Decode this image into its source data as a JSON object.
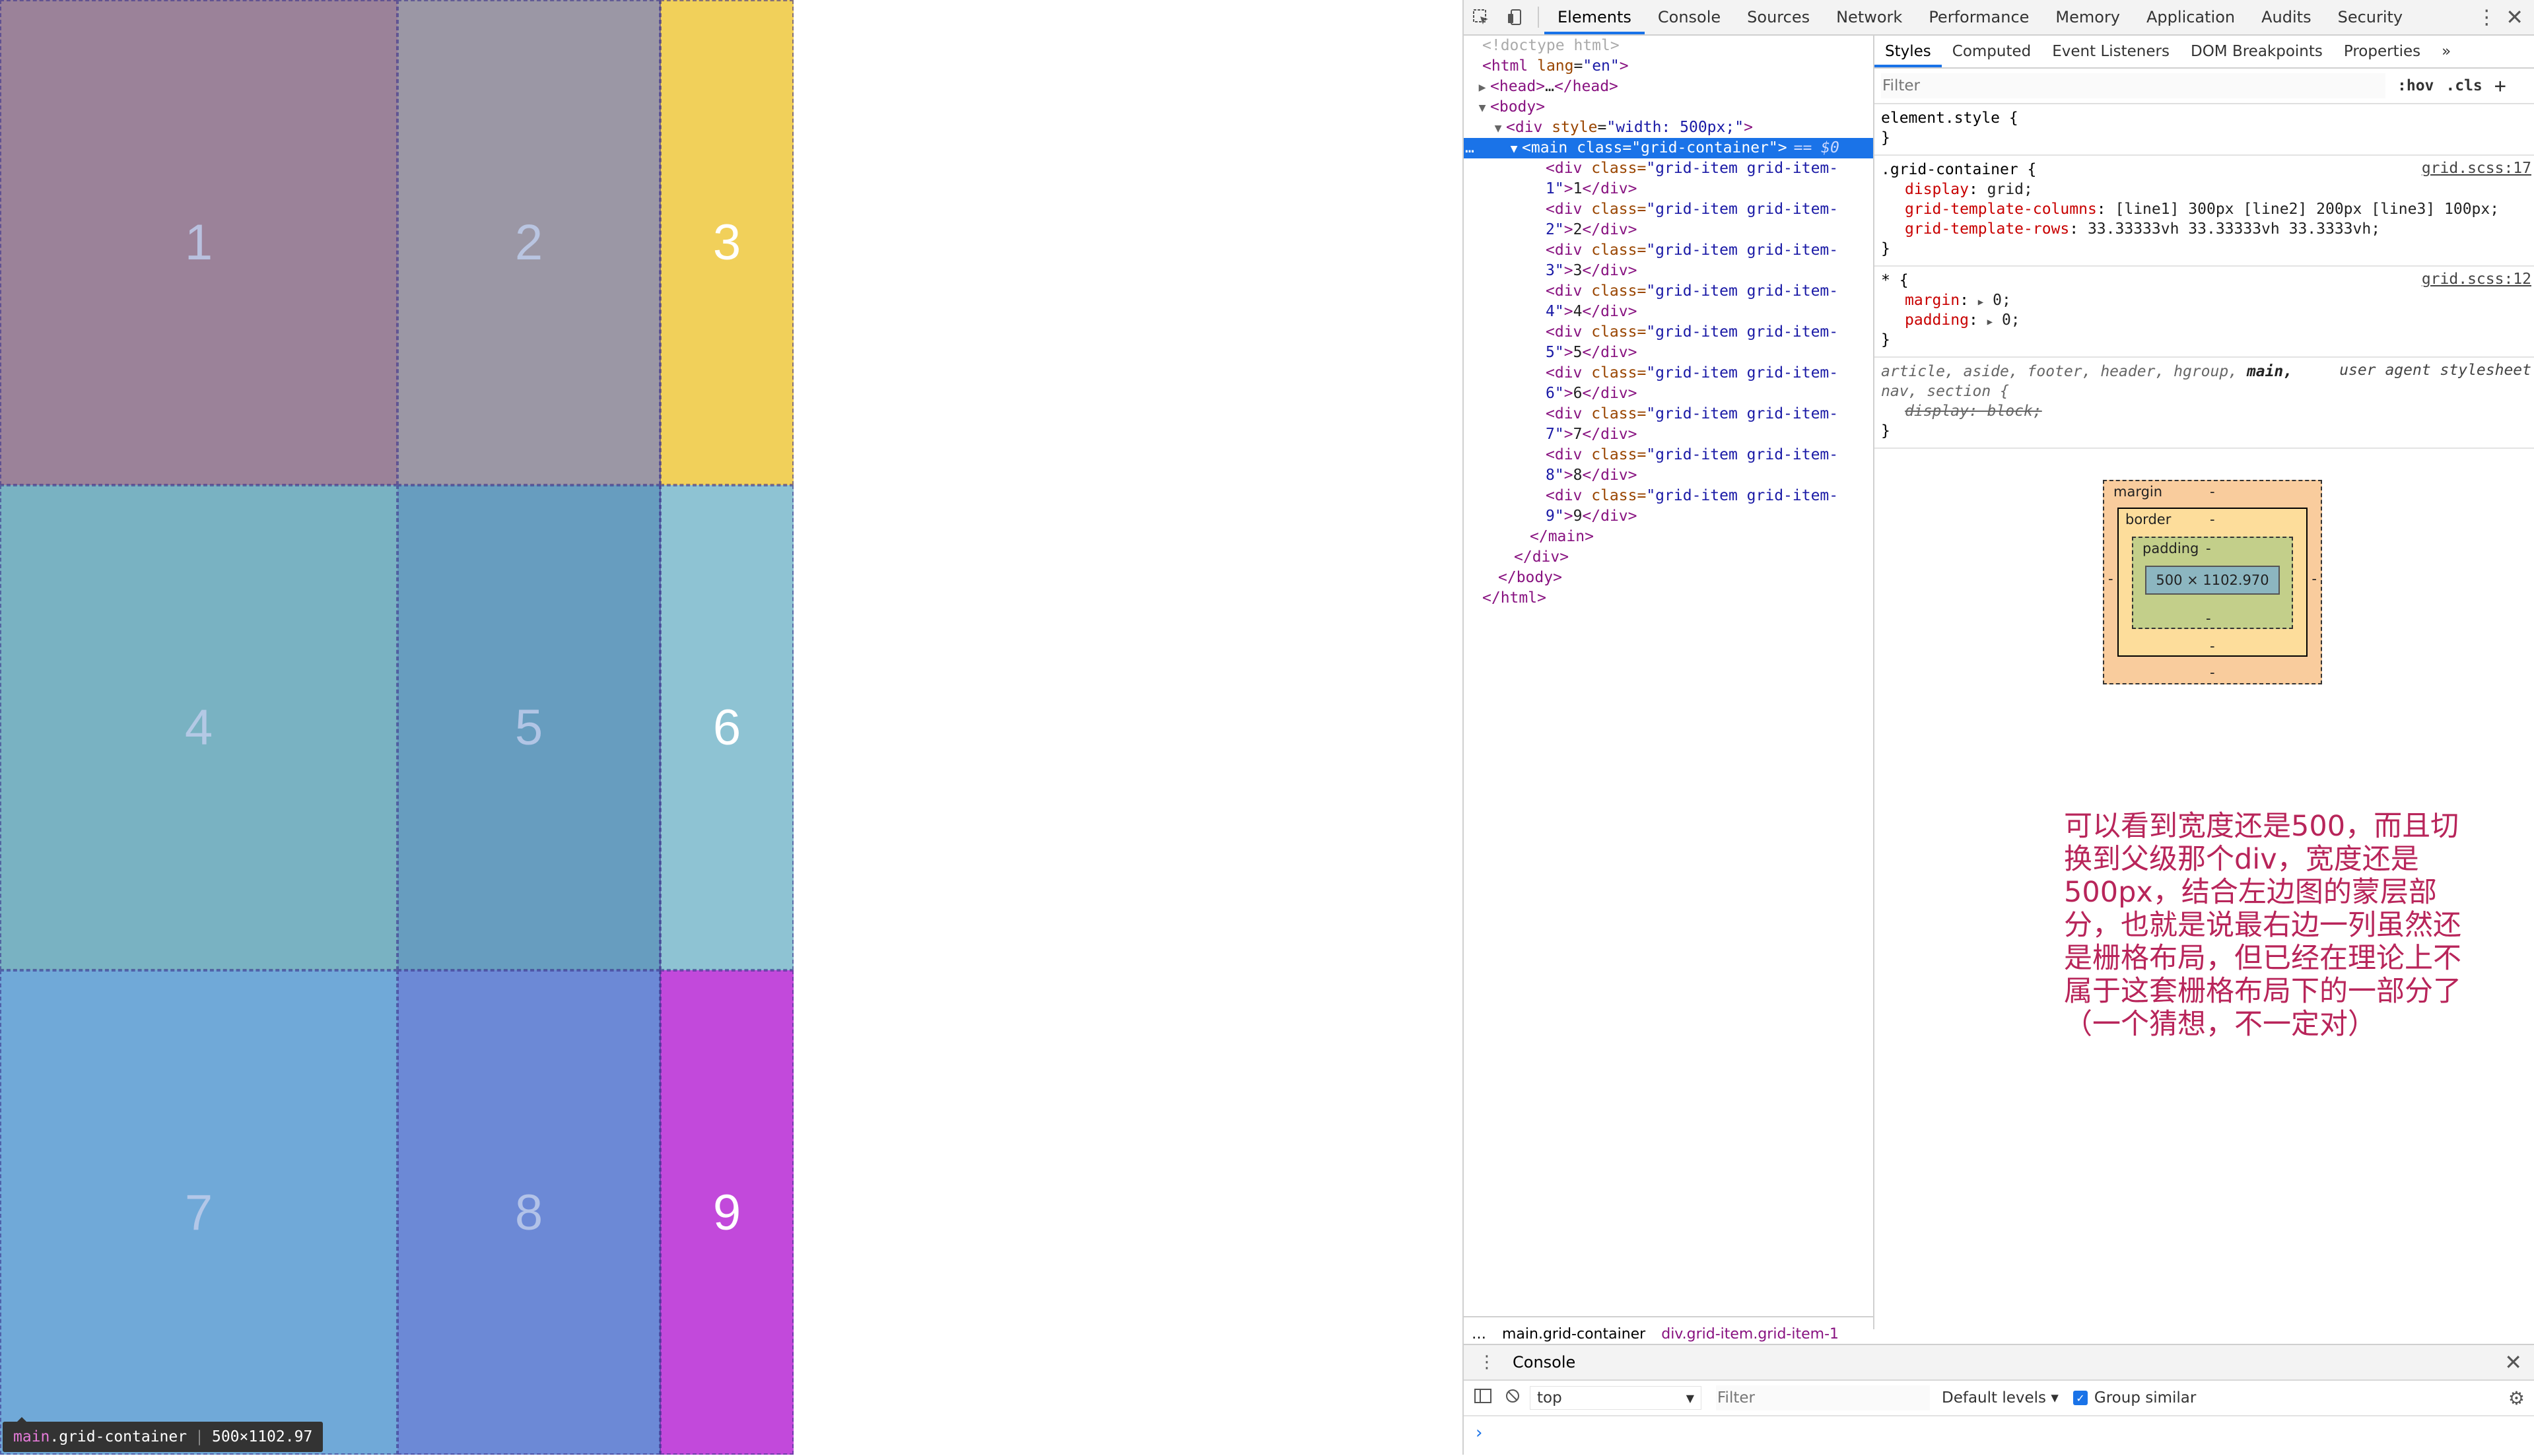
{
  "grid": {
    "cells": [
      {
        "label": "1",
        "bg": "#9b8299",
        "light": false
      },
      {
        "label": "2",
        "bg": "#9b97a5",
        "light": false
      },
      {
        "label": "3",
        "bg": "#f1d05a",
        "light": true
      },
      {
        "label": "4",
        "bg": "#79b2c2",
        "light": false
      },
      {
        "label": "5",
        "bg": "#679dbf",
        "light": false
      },
      {
        "label": "6",
        "bg": "#8ec3d3",
        "light": true
      },
      {
        "label": "7",
        "bg": "#70a9d8",
        "light": false
      },
      {
        "label": "8",
        "bg": "#6c89d6",
        "light": false
      },
      {
        "label": "9",
        "bg": "#c249db",
        "light": true
      }
    ],
    "tooltip": {
      "tag": "main",
      "cls": ".grid-container",
      "size": "500×1102.97"
    }
  },
  "devtools": {
    "tabs": [
      "Elements",
      "Console",
      "Sources",
      "Network",
      "Performance",
      "Memory",
      "Application",
      "Audits",
      "Security"
    ],
    "active_tab": "Elements",
    "dom": {
      "l0": "<!doctype html>",
      "l1_tag": "<html",
      "l1_attr": " lang",
      "l1_val": "\"en\"",
      "l1_end": ">",
      "l2_head": "<head>",
      "l2_dots": "…",
      "l2_close": "</head>",
      "l3": "<body>",
      "l4_tag": "<div",
      "l4_attr": " style",
      "l4_val": "\"width: 500px;\"",
      "l4_end": ">",
      "l5_tag": "<main",
      "l5_attr": " class",
      "l5_val": "\"grid-container\"",
      "l5_end": ">",
      "l5_eq": "== $0",
      "items": [
        {
          "a": "\"grid-item grid-item-",
          "b": "1\"",
          "n": "1"
        },
        {
          "a": "\"grid-item grid-item-",
          "b": "2\"",
          "n": "2"
        },
        {
          "a": "\"grid-item grid-item-",
          "b": "3\"",
          "n": "3"
        },
        {
          "a": "\"grid-item grid-item-",
          "b": "4\"",
          "n": "4"
        },
        {
          "a": "\"grid-item grid-item-",
          "b": "5\"",
          "n": "5"
        },
        {
          "a": "\"grid-item grid-item-",
          "b": "6\"",
          "n": "6"
        },
        {
          "a": "\"grid-item grid-item-",
          "b": "7\"",
          "n": "7"
        },
        {
          "a": "\"grid-item grid-item-",
          "b": "8\"",
          "n": "8"
        },
        {
          "a": "\"grid-item grid-item-",
          "b": "9\"",
          "n": "9"
        }
      ],
      "div_open": "<div",
      "div_class": " class=",
      "div_close_tag": "</div>",
      "close_main": "</main>",
      "close_div": "</div>",
      "close_body": "</body>",
      "close_html": "</html>"
    },
    "breadcrumb": {
      "dots": "…",
      "c1": "main.grid-container",
      "c2": "div.grid-item.grid-item-1"
    },
    "subtabs": [
      "Styles",
      "Computed",
      "Event Listeners",
      "DOM Breakpoints",
      "Properties",
      "»"
    ],
    "filter_placeholder": "Filter",
    "hov": ":hov",
    "cls": ".cls",
    "plus": "+",
    "rules": {
      "element_style": "element.style {",
      "close": "}",
      "grid_sel": ".grid-container {",
      "grid_src": "grid.scss:17",
      "display_n": "display",
      "display_v": "grid;",
      "gtc_n": "grid-template-columns",
      "gtc_v": "[line1] 300px [line2] 200px [line3] 100px;",
      "gtr_n": "grid-template-rows",
      "gtr_v": "33.33333vh 33.33333vh 33.3333vh;",
      "star_sel": "* {",
      "star_src": "grid.scss:12",
      "margin_n": "margin",
      "margin_v": "0;",
      "padding_n": "padding",
      "padding_v": "0;",
      "ua_sel1": "article, aside, footer, header, hgroup, ",
      "ua_main": "main,",
      "ua_sel2": "nav, section {",
      "ua_src": "user agent stylesheet",
      "ua_prop": "display: block;"
    },
    "boxmodel": {
      "margin": "margin",
      "border": "border",
      "padding": "padding",
      "content": "500 × 1102.970",
      "dash": "-"
    },
    "annotation": "可以看到宽度还是500，而且切换到父级那个div，宽度还是500px，结合左边图的蒙层部分，也就是说最右边一列虽然还是栅格布局，但已经在理论上不属于这套栅格布局下的一部分了（一个猜想，不一定对）",
    "console": {
      "title": "Console",
      "context": "top",
      "filter_placeholder": "Filter",
      "levels": "Default levels ▾",
      "group_similar": "Group similar",
      "prompt": "›"
    }
  },
  "colors": {
    "accent": "#1a73e8",
    "annotation": "#b8255a"
  }
}
